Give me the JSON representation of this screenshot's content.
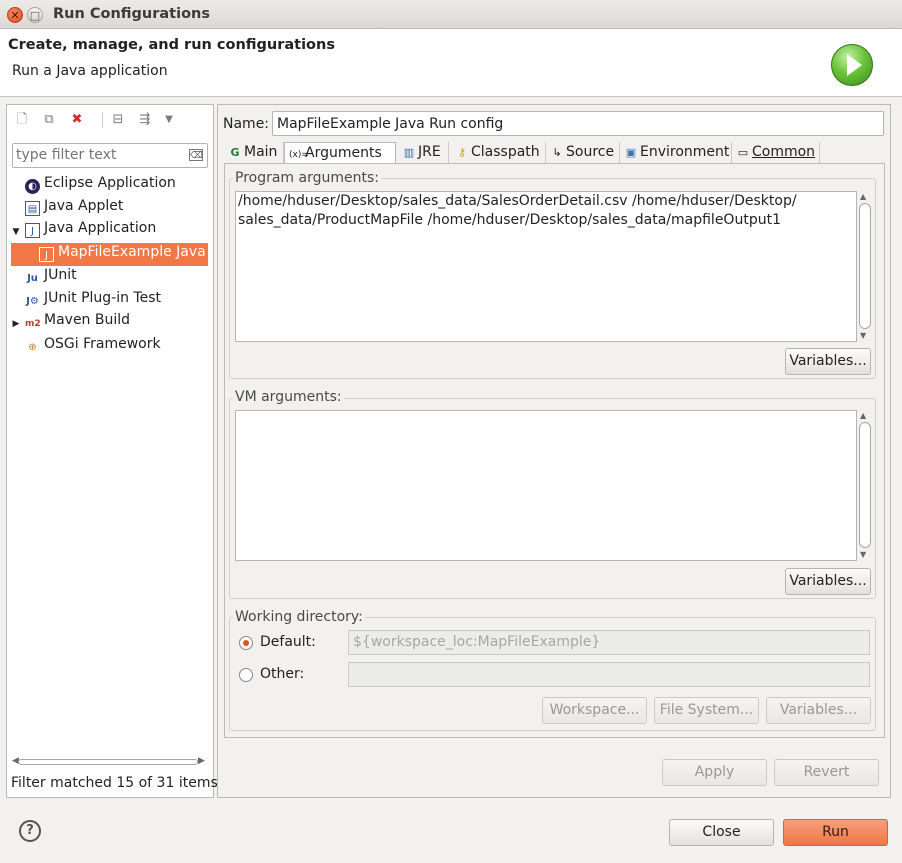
{
  "window": {
    "title": "Run Configurations"
  },
  "banner": {
    "title": "Create, manage, and run configurations",
    "subtitle": "Run a Java application"
  },
  "filter": {
    "placeholder": "type filter text",
    "clear_icon": "clear-icon"
  },
  "tree": [
    {
      "label": "Eclipse Application",
      "icon": "eclipse-icon",
      "expander": ""
    },
    {
      "label": "Java Applet",
      "icon": "applet-icon",
      "expander": ""
    },
    {
      "label": "Java Application",
      "icon": "java-app-icon",
      "expander": "▼"
    },
    {
      "label": "MapFileExample Java R",
      "icon": "java-config-icon",
      "expander": ""
    },
    {
      "label": "JUnit",
      "icon": "junit-icon",
      "expander": ""
    },
    {
      "label": "JUnit Plug-in Test",
      "icon": "junit-plugin-icon",
      "expander": ""
    },
    {
      "label": "Maven Build",
      "icon": "maven-icon",
      "expander": "▶"
    },
    {
      "label": "OSGi Framework",
      "icon": "osgi-icon",
      "expander": ""
    }
  ],
  "filter_status": "Filter matched 15 of 31 items",
  "name": {
    "label": "Name:",
    "value": "MapFileExample Java Run config"
  },
  "tabs": [
    {
      "label": "Main",
      "icon": "main-icon"
    },
    {
      "label": "Arguments",
      "icon": "arguments-icon"
    },
    {
      "label": "JRE",
      "icon": "jre-icon"
    },
    {
      "label": "Classpath",
      "icon": "classpath-icon"
    },
    {
      "label": "Source",
      "icon": "source-icon"
    },
    {
      "label": "Environment",
      "icon": "environment-icon"
    },
    {
      "label": "Common",
      "icon": "common-icon"
    }
  ],
  "program_args": {
    "label": "Program arguments:",
    "value": "/home/hduser/Desktop/sales_data/SalesOrderDetail.csv /home/hduser/Desktop/\nsales_data/ProductMapFile /home/hduser/Desktop/sales_data/mapfileOutput1",
    "variables": "Variables..."
  },
  "vm_args": {
    "label": "VM arguments:",
    "value": "",
    "variables": "Variables..."
  },
  "working_dir": {
    "label": "Working directory:",
    "default_label": "Default:",
    "default_value": "${workspace_loc:MapFileExample}",
    "other_label": "Other:",
    "other_value": "",
    "workspace": "Workspace...",
    "file_system": "File System...",
    "variables": "Variables..."
  },
  "buttons": {
    "apply": "Apply",
    "revert": "Revert",
    "close": "Close",
    "run": "Run",
    "help": "?"
  }
}
